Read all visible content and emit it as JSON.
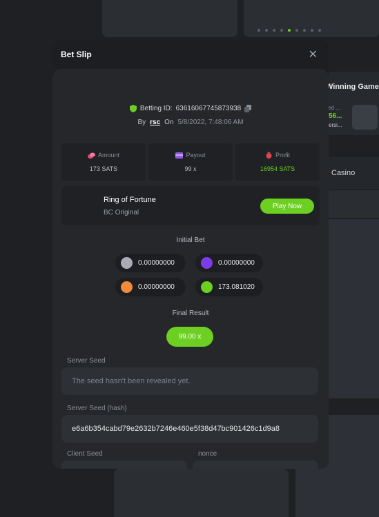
{
  "carousel": {
    "dots": 9,
    "active_index": 4
  },
  "sidebar": {
    "title": "Winning Game",
    "sub1": "ed ...",
    "sub2": "56...",
    "sub3": "ersi...",
    "casino_label": "Casino"
  },
  "modal": {
    "title": "Bet Slip",
    "close_symbol": "✕",
    "betting_id_label": "Betting ID:",
    "betting_id": "63616067745873938",
    "by_label": "By",
    "user": "rsc",
    "on_label": "On",
    "date": "5/8/2022, 7:48:06 AM",
    "stats": [
      {
        "label": "Amount",
        "value": "173 SATS",
        "icon": "coins-icon",
        "icon_color": "#e04e7a"
      },
      {
        "label": "Payout",
        "value": "99 x",
        "icon": "wallet-icon",
        "icon_color": "#8f5bdc"
      },
      {
        "label": "Profit",
        "value": "16954 SATS",
        "icon": "money-bag-icon",
        "icon_color": "#e0454e"
      }
    ],
    "game": {
      "name": "Ring of Fortune",
      "type": "BC Original",
      "play_label": "Play Now"
    },
    "initial_bet_label": "Initial Bet",
    "chips": [
      {
        "color": "#a9adb3",
        "value": "0.00000000"
      },
      {
        "color": "#7c3de8",
        "value": "0.00000000"
      },
      {
        "color": "#f08a3c",
        "value": "0.00000000"
      },
      {
        "color": "#6ccf21",
        "value": "173.081020"
      }
    ],
    "final_result_label": "Final Result",
    "final_result": "99.00 x",
    "server_seed_label": "Server Seed",
    "server_seed_value": "The seed hasn't been revealed yet.",
    "server_seed_hash_label": "Server Seed (hash)",
    "server_seed_hash": "e6a6b354cabd79e2632b7246e460e5f38d47bc901426c1d9a8",
    "client_seed_label": "Client Seed",
    "nonce_label": "nonce"
  },
  "colors": {
    "accent": "#6ccf21",
    "modal_bg": "#1c1e21",
    "panel_bg": "#25272b"
  }
}
